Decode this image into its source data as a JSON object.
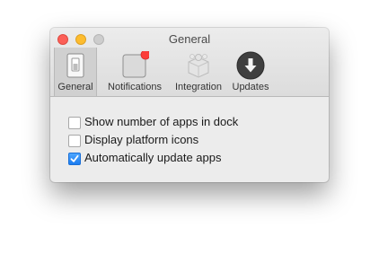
{
  "window": {
    "title": "General"
  },
  "toolbar": {
    "items": [
      {
        "label": "General",
        "icon": "switch-icon",
        "selected": true
      },
      {
        "label": "Notifications",
        "icon": "notifications-icon",
        "badge_color": "#fc3d39"
      },
      {
        "label": "Integration",
        "icon": "puzzle-icon"
      },
      {
        "label": "Updates",
        "icon": "download-arrow-icon"
      }
    ]
  },
  "settings": {
    "options": [
      {
        "label": "Show number of apps in dock",
        "checked": false
      },
      {
        "label": "Display platform icons",
        "checked": false
      },
      {
        "label": "Automatically update apps",
        "checked": true
      }
    ]
  },
  "colors": {
    "close": "#fc5f57",
    "minimize": "#fdbc2e",
    "zoom_inactive": "#cdcdcd",
    "checkbox_accent": "#1b7cf0"
  }
}
